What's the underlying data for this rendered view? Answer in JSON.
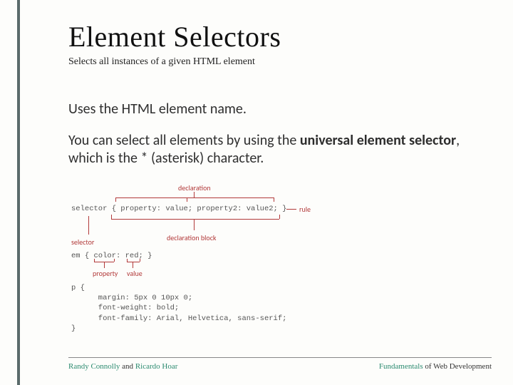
{
  "title": "Element Selectors",
  "subtitle": "Selects all instances of a given HTML element",
  "body1": "Uses the HTML element name.",
  "body2_pre": "You can select all elements by using the ",
  "body2_bold": "universal element selector",
  "body2_post": ", which is the * (asterisk) character.",
  "diagram": {
    "label_declaration": "declaration",
    "label_rule": "rule",
    "label_selector": "selector",
    "label_declaration_block": "declaration block",
    "label_property": "property",
    "label_value": "value",
    "code_line1": "selector { property: value; property2: value2; }",
    "code_line2": "em { color: red; }",
    "code_block": "p {\n      margin: 5px 0 10px 0;\n      font-weight: bold;\n      font-family: Arial, Helvetica, sans-serif;\n}"
  },
  "footer": {
    "author1": "Randy Connolly",
    "and": " and ",
    "author2": "Ricardo Hoar",
    "book_accent": "Fundamentals",
    "book_rest": " of Web Development"
  }
}
